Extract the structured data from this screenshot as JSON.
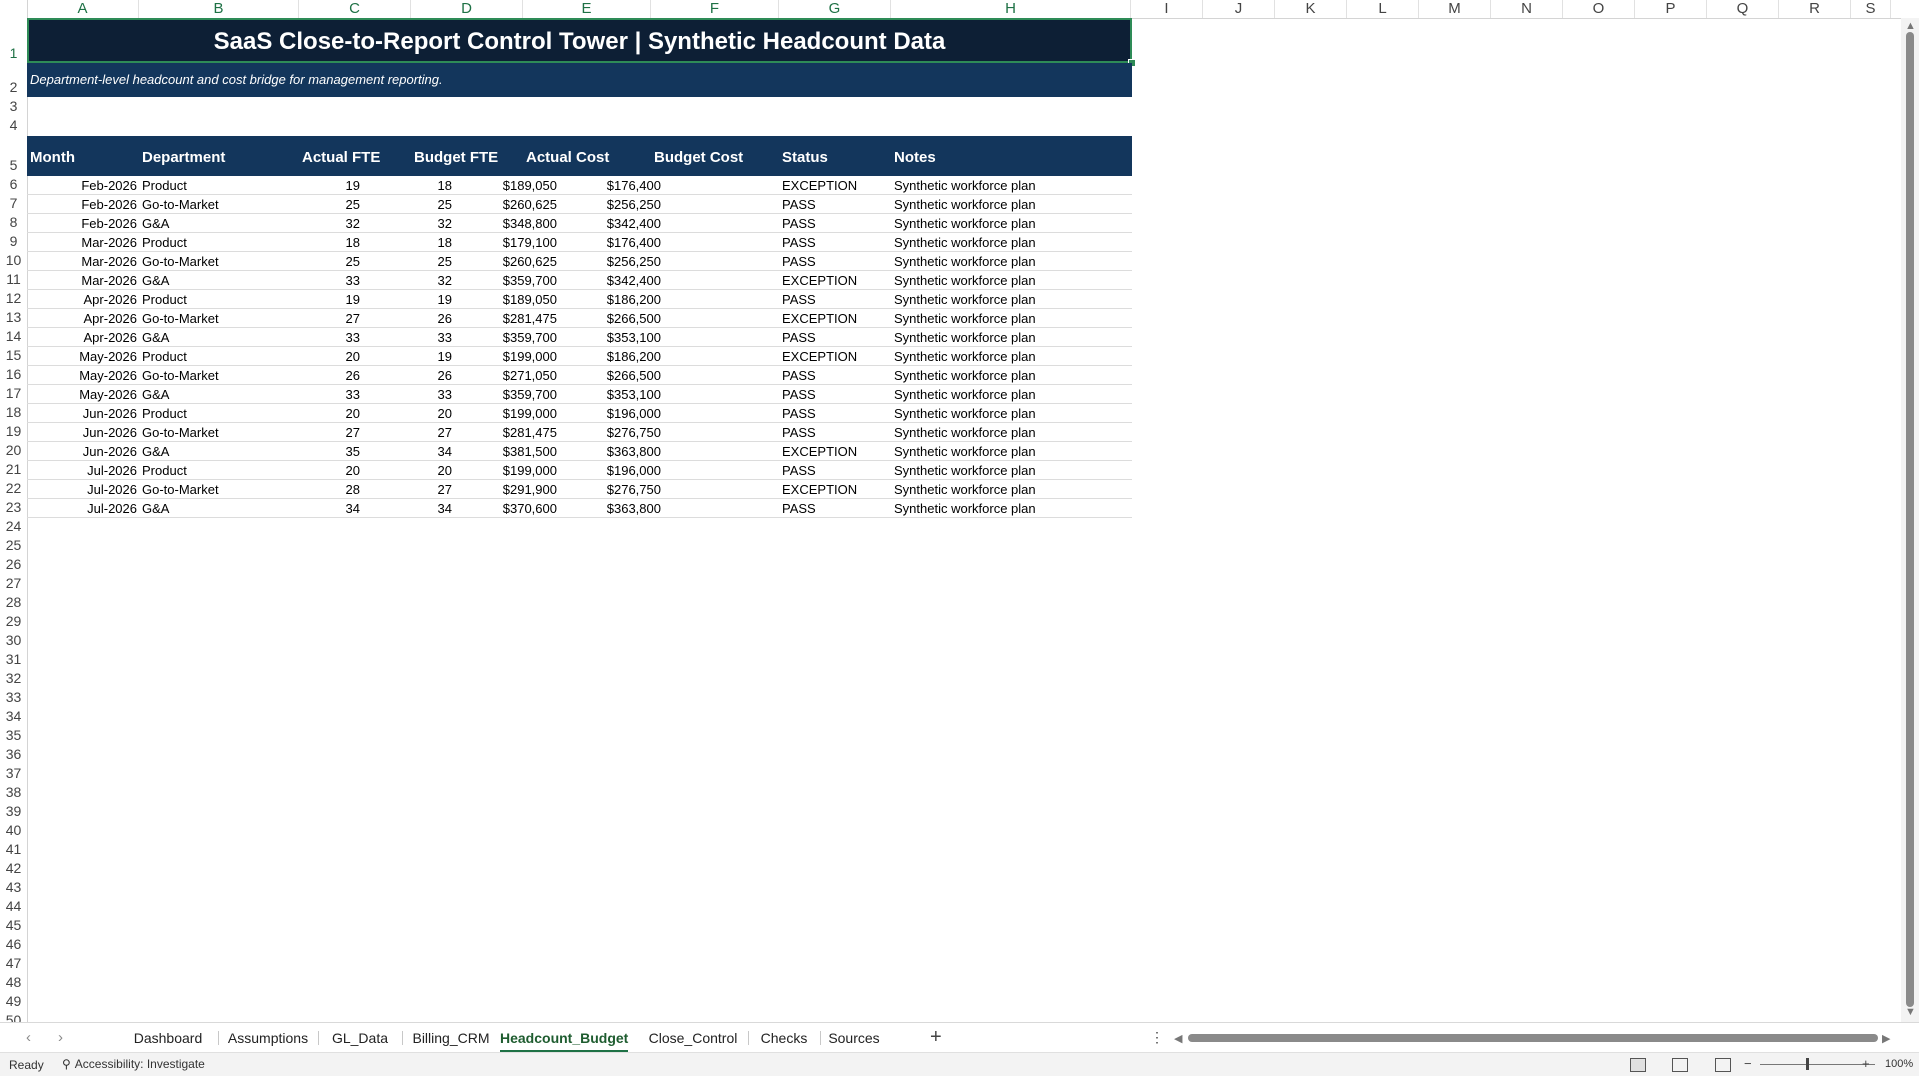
{
  "columns": [
    "A",
    "B",
    "C",
    "D",
    "E",
    "F",
    "G",
    "H",
    "I",
    "J",
    "K",
    "L",
    "M",
    "N",
    "O",
    "P",
    "Q",
    "R",
    "S"
  ],
  "rows": [
    "1",
    "2",
    "3",
    "4",
    "5",
    "6",
    "7",
    "8",
    "9",
    "10",
    "11",
    "12",
    "13",
    "14",
    "15",
    "16",
    "17",
    "18",
    "19",
    "20",
    "21",
    "22",
    "23",
    "24",
    "25",
    "26",
    "27",
    "28",
    "29",
    "30",
    "31",
    "32",
    "33",
    "34",
    "35",
    "36",
    "37",
    "38",
    "39",
    "40",
    "41",
    "42",
    "43",
    "44",
    "45",
    "46",
    "47",
    "48",
    "49",
    "50"
  ],
  "sheet": {
    "title": "SaaS Close-to-Report Control Tower | Synthetic Headcount Data",
    "subtitle": "Department-level headcount and cost bridge for management reporting.",
    "headers": {
      "month": "Month",
      "department": "Department",
      "actual_fte": "Actual FTE",
      "budget_fte": "Budget FTE",
      "actual_cost": "Actual Cost",
      "budget_cost": "Budget Cost",
      "status": "Status",
      "notes": "Notes"
    },
    "data": [
      {
        "month": "Feb-2026",
        "department": "Product",
        "actual_fte": "19",
        "budget_fte": "18",
        "actual_cost": "$189,050",
        "budget_cost": "$176,400",
        "status": "EXCEPTION",
        "notes": "Synthetic workforce plan"
      },
      {
        "month": "Feb-2026",
        "department": "Go-to-Market",
        "actual_fte": "25",
        "budget_fte": "25",
        "actual_cost": "$260,625",
        "budget_cost": "$256,250",
        "status": "PASS",
        "notes": "Synthetic workforce plan"
      },
      {
        "month": "Feb-2026",
        "department": "G&A",
        "actual_fte": "32",
        "budget_fte": "32",
        "actual_cost": "$348,800",
        "budget_cost": "$342,400",
        "status": "PASS",
        "notes": "Synthetic workforce plan"
      },
      {
        "month": "Mar-2026",
        "department": "Product",
        "actual_fte": "18",
        "budget_fte": "18",
        "actual_cost": "$179,100",
        "budget_cost": "$176,400",
        "status": "PASS",
        "notes": "Synthetic workforce plan"
      },
      {
        "month": "Mar-2026",
        "department": "Go-to-Market",
        "actual_fte": "25",
        "budget_fte": "25",
        "actual_cost": "$260,625",
        "budget_cost": "$256,250",
        "status": "PASS",
        "notes": "Synthetic workforce plan"
      },
      {
        "month": "Mar-2026",
        "department": "G&A",
        "actual_fte": "33",
        "budget_fte": "32",
        "actual_cost": "$359,700",
        "budget_cost": "$342,400",
        "status": "EXCEPTION",
        "notes": "Synthetic workforce plan"
      },
      {
        "month": "Apr-2026",
        "department": "Product",
        "actual_fte": "19",
        "budget_fte": "19",
        "actual_cost": "$189,050",
        "budget_cost": "$186,200",
        "status": "PASS",
        "notes": "Synthetic workforce plan"
      },
      {
        "month": "Apr-2026",
        "department": "Go-to-Market",
        "actual_fte": "27",
        "budget_fte": "26",
        "actual_cost": "$281,475",
        "budget_cost": "$266,500",
        "status": "EXCEPTION",
        "notes": "Synthetic workforce plan"
      },
      {
        "month": "Apr-2026",
        "department": "G&A",
        "actual_fte": "33",
        "budget_fte": "33",
        "actual_cost": "$359,700",
        "budget_cost": "$353,100",
        "status": "PASS",
        "notes": "Synthetic workforce plan"
      },
      {
        "month": "May-2026",
        "department": "Product",
        "actual_fte": "20",
        "budget_fte": "19",
        "actual_cost": "$199,000",
        "budget_cost": "$186,200",
        "status": "EXCEPTION",
        "notes": "Synthetic workforce plan"
      },
      {
        "month": "May-2026",
        "department": "Go-to-Market",
        "actual_fte": "26",
        "budget_fte": "26",
        "actual_cost": "$271,050",
        "budget_cost": "$266,500",
        "status": "PASS",
        "notes": "Synthetic workforce plan"
      },
      {
        "month": "May-2026",
        "department": "G&A",
        "actual_fte": "33",
        "budget_fte": "33",
        "actual_cost": "$359,700",
        "budget_cost": "$353,100",
        "status": "PASS",
        "notes": "Synthetic workforce plan"
      },
      {
        "month": "Jun-2026",
        "department": "Product",
        "actual_fte": "20",
        "budget_fte": "20",
        "actual_cost": "$199,000",
        "budget_cost": "$196,000",
        "status": "PASS",
        "notes": "Synthetic workforce plan"
      },
      {
        "month": "Jun-2026",
        "department": "Go-to-Market",
        "actual_fte": "27",
        "budget_fte": "27",
        "actual_cost": "$281,475",
        "budget_cost": "$276,750",
        "status": "PASS",
        "notes": "Synthetic workforce plan"
      },
      {
        "month": "Jun-2026",
        "department": "G&A",
        "actual_fte": "35",
        "budget_fte": "34",
        "actual_cost": "$381,500",
        "budget_cost": "$363,800",
        "status": "EXCEPTION",
        "notes": "Synthetic workforce plan"
      },
      {
        "month": "Jul-2026",
        "department": "Product",
        "actual_fte": "20",
        "budget_fte": "20",
        "actual_cost": "$199,000",
        "budget_cost": "$196,000",
        "status": "PASS",
        "notes": "Synthetic workforce plan"
      },
      {
        "month": "Jul-2026",
        "department": "Go-to-Market",
        "actual_fte": "28",
        "budget_fte": "27",
        "actual_cost": "$291,900",
        "budget_cost": "$276,750",
        "status": "EXCEPTION",
        "notes": "Synthetic workforce plan"
      },
      {
        "month": "Jul-2026",
        "department": "G&A",
        "actual_fte": "34",
        "budget_fte": "34",
        "actual_cost": "$370,600",
        "budget_cost": "$363,800",
        "status": "PASS",
        "notes": "Synthetic workforce plan"
      }
    ]
  },
  "tabs": [
    {
      "label": "Dashboard",
      "active": false
    },
    {
      "label": "Assumptions",
      "active": false
    },
    {
      "label": "GL_Data",
      "active": false
    },
    {
      "label": "Billing_CRM",
      "active": false
    },
    {
      "label": "Headcount_Budget",
      "active": true
    },
    {
      "label": "Close_Control",
      "active": false
    },
    {
      "label": "Checks",
      "active": false
    },
    {
      "label": "Sources",
      "active": false
    }
  ],
  "status_bar": {
    "ready": "Ready",
    "accessibility": "Accessibility: Investigate",
    "zoom": "100%"
  },
  "colors": {
    "title_bg": "#0d1f35",
    "header_bg": "#13365c",
    "selection": "#2e8b57",
    "active_tab": "#1e7145"
  },
  "icons": [
    "tab-prev-icon",
    "tab-next-icon",
    "add-sheet-icon",
    "more-icon",
    "accessibility-icon",
    "normal-view-icon",
    "page-layout-icon",
    "page-break-icon"
  ]
}
